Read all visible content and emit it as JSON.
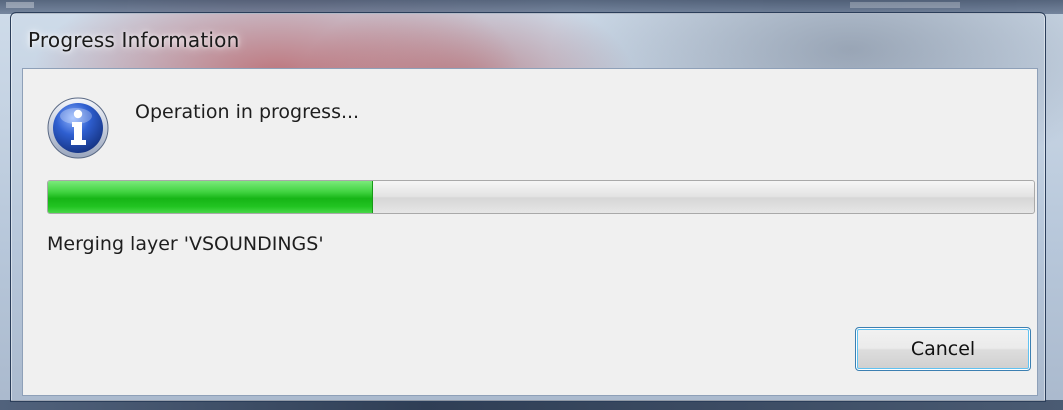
{
  "window": {
    "title": "Progress Information"
  },
  "dialog": {
    "icon": "information-icon",
    "message": "Operation in progress...",
    "progress": {
      "fraction": 0.33,
      "color": "#22c422"
    },
    "status_text": "Merging layer 'VSOUNDINGS'",
    "cancel_label": "Cancel"
  }
}
